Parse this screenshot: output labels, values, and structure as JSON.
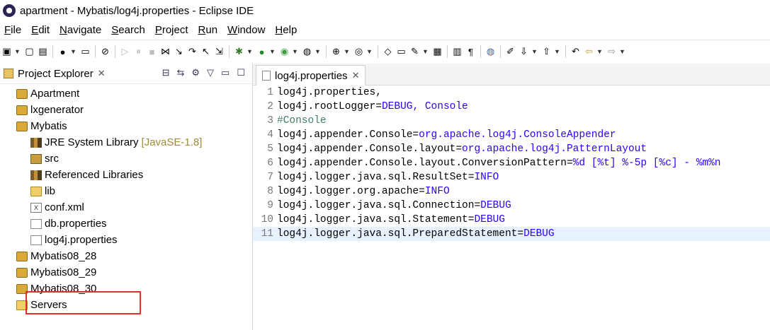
{
  "window": {
    "title": "apartment - Mybatis/log4j.properties - Eclipse IDE"
  },
  "menu": [
    "File",
    "Edit",
    "Navigate",
    "Search",
    "Project",
    "Run",
    "Window",
    "Help"
  ],
  "toolbar_icons": [
    "new-icon",
    "save-icon",
    "save-all-icon",
    "person-icon",
    "terminal-icon",
    "skip-breakpoints-icon",
    "resume-icon",
    "suspend-icon",
    "terminate-icon",
    "disconnect-icon",
    "step-into-icon",
    "step-over-icon",
    "step-return-icon",
    "drop-frame-icon",
    "debug-icon",
    "run-icon",
    "coverage-icon",
    "external-tools-icon",
    "new-server-icon",
    "new-web-icon",
    "open-type-icon",
    "open-folder-icon",
    "open-task-icon",
    "toggle-mark-icon",
    "show-whitespace-icon",
    "pilcrow-icon",
    "globe-icon",
    "annotation-icon",
    "next-annotation-icon",
    "prev-annotation-icon",
    "last-edit-icon",
    "back-icon",
    "forward-icon"
  ],
  "explorer": {
    "title": "Project Explorer",
    "items": [
      {
        "label": "Apartment",
        "level": 0,
        "arrow": "›",
        "icon": "project-icon"
      },
      {
        "label": "lxgenerator",
        "level": 0,
        "arrow": "›",
        "icon": "project-icon"
      },
      {
        "label": "Mybatis",
        "level": 0,
        "arrow": "⌄",
        "icon": "project-icon"
      },
      {
        "label": "JRE System Library",
        "detail": "[JavaSE-1.8]",
        "level": 1,
        "arrow": "›",
        "icon": "library-icon"
      },
      {
        "label": "src",
        "level": 1,
        "arrow": "›",
        "icon": "package-folder-icon"
      },
      {
        "label": "Referenced Libraries",
        "level": 1,
        "arrow": "›",
        "icon": "library-icon"
      },
      {
        "label": "lib",
        "level": 1,
        "arrow": "›",
        "icon": "folder-icon"
      },
      {
        "label": "conf.xml",
        "level": 1,
        "arrow": "",
        "icon": "xml-file-icon"
      },
      {
        "label": "db.properties",
        "level": 1,
        "arrow": "",
        "icon": "file-icon"
      },
      {
        "label": "log4j.properties",
        "level": 1,
        "arrow": "",
        "icon": "file-icon",
        "highlighted": true
      },
      {
        "label": "Mybatis08_28",
        "level": 0,
        "arrow": "›",
        "icon": "project-icon"
      },
      {
        "label": "Mybatis08_29",
        "level": 0,
        "arrow": "›",
        "icon": "project-icon"
      },
      {
        "label": "Mybatis08_30",
        "level": 0,
        "arrow": "›",
        "icon": "project-icon"
      },
      {
        "label": "Servers",
        "level": 0,
        "arrow": "›",
        "icon": "folder-icon"
      }
    ]
  },
  "editor": {
    "tab_label": "log4j.properties",
    "current_line": 11,
    "lines": [
      {
        "num": "1",
        "parts": [
          {
            "t": "log4j.properties,",
            "s": "k"
          }
        ]
      },
      {
        "num": "2",
        "parts": [
          {
            "t": "log4j.rootLogger=",
            "s": "k"
          },
          {
            "t": "DEBUG, Console",
            "s": "v"
          }
        ]
      },
      {
        "num": "3",
        "parts": [
          {
            "t": "#Console",
            "s": "c"
          }
        ]
      },
      {
        "num": "4",
        "parts": [
          {
            "t": "log4j.appender.Console=",
            "s": "k"
          },
          {
            "t": "org.apache.log4j.ConsoleAppender",
            "s": "v"
          }
        ]
      },
      {
        "num": "5",
        "parts": [
          {
            "t": "log4j.appender.Console.layout=",
            "s": "k"
          },
          {
            "t": "org.apache.log4j.PatternLayout",
            "s": "v"
          }
        ]
      },
      {
        "num": "6",
        "parts": [
          {
            "t": "log4j.appender.Console.layout.ConversionPattern=",
            "s": "k"
          },
          {
            "t": "%d [%t] %-5p [%c] - %m%n",
            "s": "v"
          }
        ]
      },
      {
        "num": "7",
        "parts": [
          {
            "t": "log4j.logger.java.sql.ResultSet=",
            "s": "k"
          },
          {
            "t": "INFO",
            "s": "v"
          }
        ]
      },
      {
        "num": "8",
        "parts": [
          {
            "t": "log4j.logger.org.apache=",
            "s": "k"
          },
          {
            "t": "INFO",
            "s": "v"
          }
        ]
      },
      {
        "num": "9",
        "parts": [
          {
            "t": "log4j.logger.java.sql.Connection=",
            "s": "k"
          },
          {
            "t": "DEBUG",
            "s": "v"
          }
        ]
      },
      {
        "num": "10",
        "parts": [
          {
            "t": "log4j.logger.java.sql.Statement=",
            "s": "k"
          },
          {
            "t": "DEBUG",
            "s": "v"
          }
        ]
      },
      {
        "num": "11",
        "parts": [
          {
            "t": "log4j.logger.java.sql.PreparedStatement=",
            "s": "k"
          },
          {
            "t": "DEBUG",
            "s": "v"
          }
        ]
      }
    ]
  },
  "colors": {
    "key": "#000000",
    "value": "#2a00ff",
    "comment": "#3f7f5f",
    "highlight_box": "#e0302a",
    "current_line": "#e8f2fe"
  }
}
